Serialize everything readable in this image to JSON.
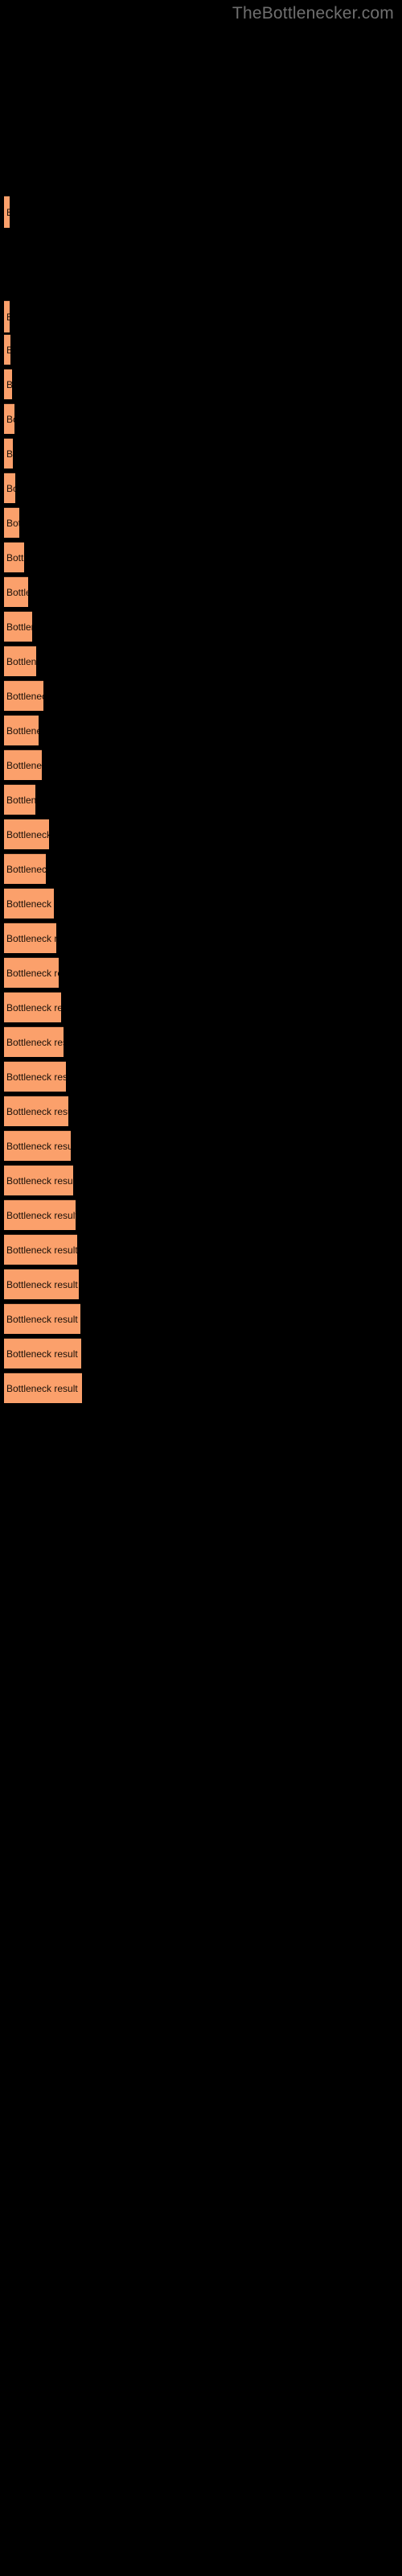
{
  "site": {
    "title": "TheBottlenecker.com",
    "title_color": "#6f6f6f"
  },
  "colors": {
    "background": "#000000",
    "bar_fill": "#fba06b",
    "bar_border": "#2a1a10",
    "label_text": "#1a1008"
  },
  "bar_label": "Bottleneck result",
  "chart_data": {
    "type": "bar",
    "orientation": "horizontal",
    "title": "TheBottlenecker.com",
    "xlabel": "",
    "ylabel": "",
    "grid": false,
    "legend": false,
    "categories": [
      "Bottleneck result",
      "Bottleneck result",
      "Bottleneck result",
      "Bottleneck result",
      "Bottleneck result",
      "Bottleneck result",
      "Bottleneck result",
      "Bottleneck result",
      "Bottleneck result",
      "Bottleneck result",
      "Bottleneck result",
      "Bottleneck result",
      "Bottleneck result",
      "Bottleneck result",
      "Bottleneck result",
      "Bottleneck result",
      "Bottleneck result",
      "Bottleneck result",
      "Bottleneck result",
      "Bottleneck result",
      "Bottleneck result",
      "Bottleneck result",
      "Bottleneck result",
      "Bottleneck result",
      "Bottleneck result",
      "Bottleneck result",
      "Bottleneck result",
      "Bottleneck result",
      "Bottleneck result",
      "Bottleneck result",
      "Bottleneck result",
      "Bottleneck result",
      "Bottleneck result"
    ],
    "values": [
      2,
      2,
      3,
      5,
      8,
      6,
      9,
      14,
      20,
      25,
      30,
      35,
      44,
      38,
      42,
      34,
      51,
      47,
      57,
      60,
      63,
      66,
      69,
      72,
      75,
      78,
      81,
      84,
      86,
      88,
      90,
      91,
      92
    ],
    "xlim": [
      0,
      100
    ],
    "bars": [
      {
        "y": 243,
        "height": 40,
        "width": 2
      },
      {
        "y": 373,
        "height": 40,
        "width": 2
      },
      {
        "y": 415,
        "height": 38,
        "width": 3
      },
      {
        "y": 458,
        "height": 38,
        "width": 5
      },
      {
        "y": 501,
        "height": 38,
        "width": 14
      },
      {
        "y": 544,
        "height": 38,
        "width": 9
      },
      {
        "y": 587,
        "height": 38,
        "width": 15
      },
      {
        "y": 630,
        "height": 38,
        "width": 31
      },
      {
        "y": 673,
        "height": 38,
        "width": 50
      },
      {
        "y": 716,
        "height": 38,
        "width": 45
      },
      {
        "y": 759,
        "height": 38,
        "width": 60
      },
      {
        "y": 802,
        "height": 38,
        "width": 72
      },
      {
        "y": 845,
        "height": 38,
        "width": 57
      },
      {
        "y": 888,
        "height": 38,
        "width": 67
      },
      {
        "y": 931,
        "height": 38,
        "width": 51
      },
      {
        "y": 974,
        "height": 38,
        "width": 76
      },
      {
        "y": 1017,
        "height": 38,
        "width": 64
      },
      {
        "y": 1060,
        "height": 38,
        "width": 80
      },
      {
        "y": 1103,
        "height": 38,
        "width": 84
      },
      {
        "y": 1146,
        "height": 38,
        "width": 88
      },
      {
        "y": 1189,
        "height": 38,
        "width": 85
      },
      {
        "y": 1232,
        "height": 38,
        "width": 78
      },
      {
        "y": 1275,
        "height": 38,
        "width": 83
      },
      {
        "y": 1318,
        "height": 38,
        "width": 86
      },
      {
        "y": 1361,
        "height": 38,
        "width": 88
      },
      {
        "y": 1404,
        "height": 38,
        "width": 90
      },
      {
        "y": 1447,
        "height": 38,
        "width": 92
      },
      {
        "y": 1490,
        "height": 38,
        "width": 93
      },
      {
        "y": 1533,
        "height": 38,
        "width": 94
      },
      {
        "y": 1576,
        "height": 38,
        "width": 95
      },
      {
        "y": 1619,
        "height": 38,
        "width": 95
      },
      {
        "y": 1662,
        "height": 38,
        "width": 96
      },
      {
        "y": 1705,
        "height": 38,
        "width": 96
      }
    ]
  },
  "bars": [
    {
      "top": 243,
      "height": 40,
      "width": 2,
      "label": "Bottleneck result"
    },
    {
      "top": 374,
      "height": 40,
      "width": 2,
      "label": "Bottleneck result"
    },
    {
      "top": 418,
      "height": 38,
      "width": 4,
      "label": "Bottleneck result"
    },
    {
      "top": 460,
      "height": 38,
      "width": 9,
      "label": "Bottleneck result"
    },
    {
      "top": 503,
      "height": 38,
      "width": 16,
      "label": "Bottleneck result"
    },
    {
      "top": 546,
      "height": 38,
      "width": 12,
      "label": "Bottleneck result"
    },
    {
      "top": 589,
      "height": 38,
      "width": 17,
      "label": "Bottleneck result"
    },
    {
      "top": 632,
      "height": 38,
      "width": 31,
      "label": "Bottleneck result"
    },
    {
      "top": 675,
      "height": 38,
      "width": 51,
      "label": "Bottleneck result"
    },
    {
      "top": 718,
      "height": 38,
      "width": 45,
      "label": "Bottleneck result"
    },
    {
      "top": 761,
      "height": 38,
      "width": 61,
      "label": "Bottleneck result"
    },
    {
      "top": 804,
      "height": 38,
      "width": 72,
      "label": "Bottleneck result"
    },
    {
      "top": 847,
      "height": 38,
      "width": 57,
      "label": "Bottleneck result"
    },
    {
      "top": 890,
      "height": 38,
      "width": 67,
      "label": "Bottleneck result"
    },
    {
      "top": 933,
      "height": 38,
      "width": 51,
      "label": "Bottleneck result"
    },
    {
      "top": 976,
      "height": 38,
      "width": 76,
      "label": "Bottleneck result"
    },
    {
      "top": 1019,
      "height": 38,
      "width": 65,
      "label": "Bottleneck result"
    },
    {
      "top": 1062,
      "height": 38,
      "width": 80,
      "label": "Bottleneck result"
    },
    {
      "top": 1105,
      "height": 38,
      "width": 84,
      "label": "Bottleneck result"
    },
    {
      "top": 1148,
      "height": 38,
      "width": 88,
      "label": "Bottleneck result"
    },
    {
      "top": 1191,
      "height": 38,
      "width": 85,
      "label": "Bottleneck result"
    },
    {
      "top": 1234,
      "height": 38,
      "width": 80,
      "label": "Bottleneck result"
    },
    {
      "top": 1277,
      "height": 38,
      "width": 84,
      "label": "Bottleneck result"
    },
    {
      "top": 1320,
      "height": 38,
      "width": 86,
      "label": "Bottleneck result"
    },
    {
      "top": 1363,
      "height": 38,
      "width": 88,
      "label": "Bottleneck result"
    },
    {
      "top": 1406,
      "height": 38,
      "width": 90,
      "label": "Bottleneck result"
    },
    {
      "top": 1449,
      "height": 38,
      "width": 92,
      "label": "Bottleneck result"
    },
    {
      "top": 1492,
      "height": 38,
      "width": 93,
      "label": "Bottleneck result"
    },
    {
      "top": 1535,
      "height": 38,
      "width": 94,
      "label": "Bottleneck result"
    },
    {
      "top": 1578,
      "height": 38,
      "width": 95,
      "label": "Bottleneck result"
    },
    {
      "top": 1621,
      "height": 38,
      "width": 95,
      "label": "Bottleneck result"
    },
    {
      "top": 1664,
      "height": 38,
      "width": 96,
      "label": "Bottleneck result"
    },
    {
      "top": 1707,
      "height": 38,
      "width": 96,
      "label": "Bottleneck result"
    }
  ]
}
